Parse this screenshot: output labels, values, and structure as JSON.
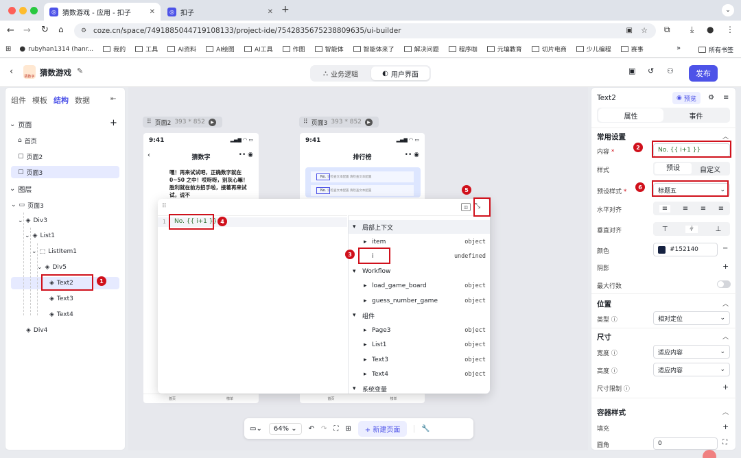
{
  "browser": {
    "tabs": [
      {
        "title": "猜数游戏 - 应用 - 扣子",
        "active": true
      },
      {
        "title": "扣子",
        "active": false
      }
    ],
    "url": "coze.cn/space/7491885044719108133/project-ide/7542835675238809635/ui-builder",
    "bookmarks": [
      "rubyhan1314 (hanr...",
      "我的",
      "工具",
      "AI资料",
      "AI绘图",
      "AI工具",
      "作图",
      "智能体",
      "智能体来了",
      "解决问题",
      "程序咖",
      "元壤教育",
      "切片电商",
      "少儿编程",
      "赛事"
    ],
    "all_bookmarks": "所有书签"
  },
  "app": {
    "name": "猜数游戏",
    "logo_text": "猜数字",
    "modes": [
      "业务逻辑",
      "用户界面"
    ],
    "active_mode": "用户界面",
    "publish": "发布"
  },
  "left_panel": {
    "tabs": [
      "组件",
      "模板",
      "结构",
      "数据"
    ],
    "active_tab": "结构",
    "pages_title": "页面",
    "pages": [
      "首页",
      "页面2",
      "页面3"
    ],
    "layers_title": "图层",
    "layers": [
      "页面3",
      "Div3",
      "List1",
      "ListItem1",
      "Div5",
      "Text2",
      "Text3",
      "Text4",
      "Div4"
    ],
    "selected_layer": "Text2"
  },
  "canvas": {
    "frames": [
      {
        "name": "页面2",
        "size": "393 * 852",
        "time": "9:41",
        "title": "猜数字",
        "body": "嘿！再来试试吧，正确数字就在 0~50 之中！哎呀呀，别灰心嘛！胜利就在前方招手啦，接着再来试试，说不",
        "nav": [
          "首页",
          "榜单"
        ]
      },
      {
        "name": "页面3",
        "size": "393 * 852",
        "time": "9:41",
        "title": "排行榜",
        "item_text": "请检查文本配置 请检查文本配置",
        "nav": [
          "首页",
          "榜单"
        ]
      }
    ],
    "zoom": "64%",
    "new_page": "新建页面"
  },
  "popup": {
    "line_number": "1",
    "code": "No. {{ i+1 }}",
    "context_sections": [
      {
        "title": "局部上下文",
        "items": [
          {
            "name": "item",
            "type": "object",
            "expandable": true
          },
          {
            "name": "i",
            "type": "undefined",
            "expandable": false
          }
        ]
      },
      {
        "title": "Workflow",
        "items": [
          {
            "name": "load_game_board",
            "type": "object",
            "expandable": true
          },
          {
            "name": "guess_number_game",
            "type": "object",
            "expandable": true
          }
        ]
      },
      {
        "title": "组件",
        "items": [
          {
            "name": "Page3",
            "type": "object",
            "expandable": true
          },
          {
            "name": "List1",
            "type": "object",
            "expandable": true
          },
          {
            "name": "Text3",
            "type": "object",
            "expandable": true
          },
          {
            "name": "Text4",
            "type": "object",
            "expandable": true
          }
        ]
      },
      {
        "title": "系统变量",
        "items": []
      }
    ]
  },
  "right_panel": {
    "component": "Text2",
    "preview": "预览",
    "tabs": [
      "属性",
      "事件"
    ],
    "active_tab": "属性",
    "common_title": "常用设置",
    "content_label": "内容",
    "content_value": "No. {{ i+1 }}",
    "style_label": "样式",
    "style_options": [
      "预设",
      "自定义"
    ],
    "preset_label": "预设样式",
    "preset_value": "标题五",
    "halign_label": "水平对齐",
    "valign_label": "垂直对齐",
    "color_label": "颜色",
    "color_value": "#152140",
    "shadow_label": "阴影",
    "maxlines_label": "最大行数",
    "position_title": "位置",
    "type_label": "类型",
    "type_value": "相对定位",
    "size_title": "尺寸",
    "width_label": "宽度",
    "width_value": "适应内容",
    "height_label": "高度",
    "height_value": "适应内容",
    "limit_label": "尺寸限制",
    "container_title": "容器样式",
    "fill_label": "填充",
    "radius_label": "圆角",
    "radius_value": "0"
  },
  "annotations": [
    "1",
    "2",
    "3",
    "4",
    "5",
    "6"
  ],
  "colors": {
    "accent": "#4d53e8",
    "annotation": "#d0101b",
    "selected_bg": "#e6eaff",
    "text_color_swatch": "#152140"
  }
}
